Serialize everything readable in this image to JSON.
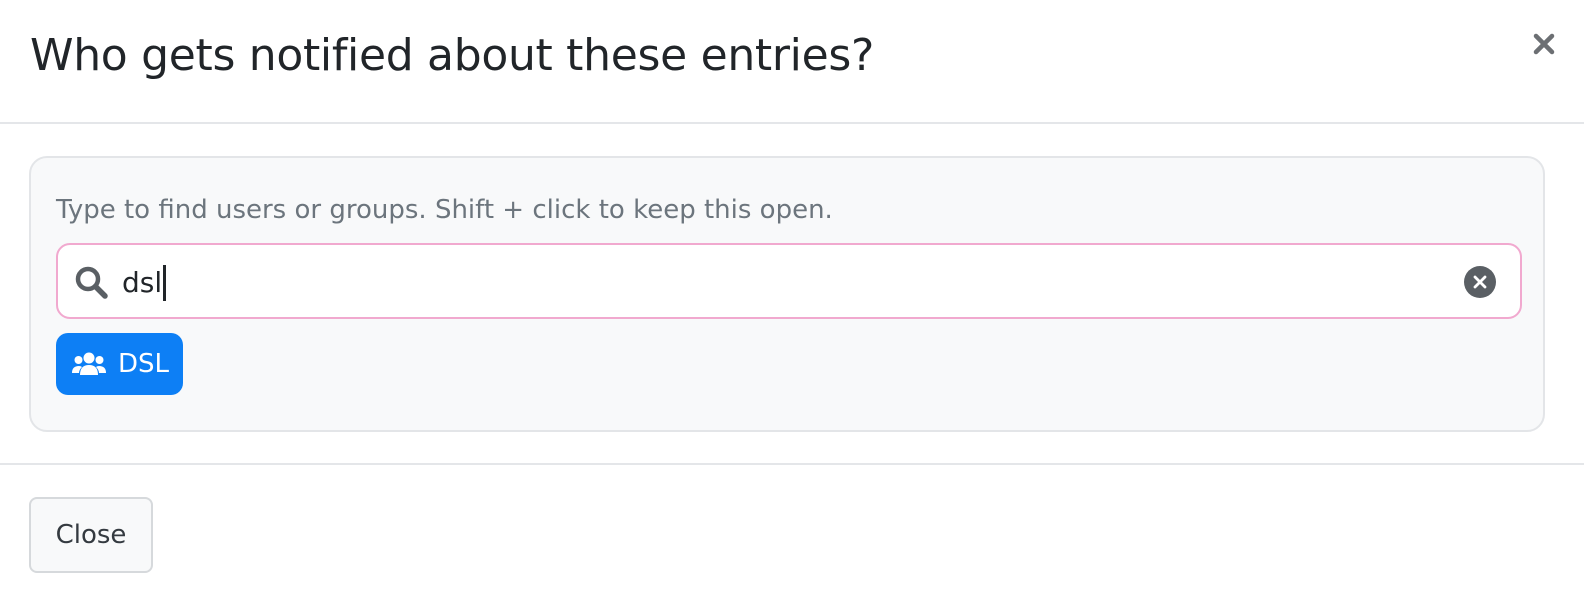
{
  "modal": {
    "title": "Who gets notified about these entries?",
    "close_icon": "close-icon"
  },
  "finder": {
    "hint": "Type to find users or groups. Shift + click to keep this open.",
    "search_value": "dsl",
    "search_icon": "search-icon",
    "clear_icon": "clear-circle-icon",
    "results": [
      {
        "label": "DSL",
        "icon": "group-icon",
        "type": "group"
      }
    ]
  },
  "footer": {
    "close_label": "Close"
  },
  "colors": {
    "chip_bg": "#0d7ff5",
    "search_border": "#f1a9cf",
    "panel_bg": "#f8f9fa"
  }
}
